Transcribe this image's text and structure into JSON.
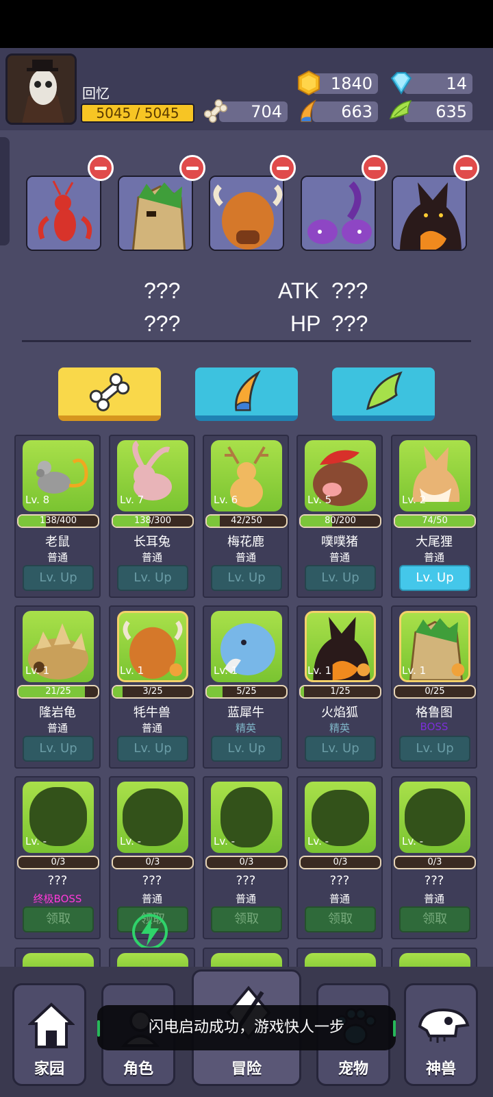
{
  "player": {
    "name": "回忆",
    "hp": "5045 / 5045"
  },
  "resources": {
    "gold": "1840",
    "diamond": "14",
    "bone": "704",
    "horn": "663",
    "wing": "635"
  },
  "team_stats": {
    "row1_left": "???",
    "row1_label": "ATK",
    "row1_value": "???",
    "row2_left": "???",
    "row2_label": "HP",
    "row2_value": "???"
  },
  "cards": [
    {
      "name": "老鼠",
      "rarity": "普通",
      "level": "Lv. 8",
      "progress": "138/400",
      "fill": 0.345,
      "button": "Lv. Up"
    },
    {
      "name": "长耳兔",
      "rarity": "普通",
      "level": "Lv. 7",
      "progress": "138/300",
      "fill": 0.46,
      "button": "Lv. Up"
    },
    {
      "name": "梅花鹿",
      "rarity": "普通",
      "level": "Lv. 6",
      "progress": "42/250",
      "fill": 0.168,
      "button": "Lv. Up"
    },
    {
      "name": "噗噗猪",
      "rarity": "普通",
      "level": "Lv. 5",
      "progress": "80/200",
      "fill": 0.4,
      "button": "Lv. Up"
    },
    {
      "name": "大尾狸",
      "rarity": "普通",
      "level": "Lv. 2",
      "progress": "74/50",
      "fill": 1.0,
      "button": "Lv. Up"
    },
    {
      "name": "隆岩龟",
      "rarity": "普通",
      "level": "Lv. 1",
      "progress": "21/25",
      "fill": 0.84,
      "button": "Lv. Up"
    },
    {
      "name": "牦牛兽",
      "rarity": "普通",
      "level": "Lv. 1",
      "progress": "3/25",
      "fill": 0.12,
      "button": "Lv. Up"
    },
    {
      "name": "蓝犀牛",
      "rarity": "精英",
      "level": "Lv. 1",
      "progress": "5/25",
      "fill": 0.2,
      "button": "Lv. Up"
    },
    {
      "name": "火焰狐",
      "rarity": "精英",
      "level": "Lv. 1",
      "progress": "1/25",
      "fill": 0.04,
      "button": "Lv. Up"
    },
    {
      "name": "格鲁图",
      "rarity": "BOSS",
      "level": "Lv. 1",
      "progress": "0/25",
      "fill": 0,
      "button": "Lv. Up"
    },
    {
      "name": "???",
      "rarity": "终极BOSS",
      "level": "Lv. -",
      "progress": "0/3",
      "fill": 0,
      "button": "领取"
    },
    {
      "name": "???",
      "rarity": "普通",
      "level": "Lv. -",
      "progress": "0/3",
      "fill": 0,
      "button": "领取"
    },
    {
      "name": "???",
      "rarity": "普通",
      "level": "Lv. -",
      "progress": "0/3",
      "fill": 0,
      "button": "领取"
    },
    {
      "name": "???",
      "rarity": "普通",
      "level": "Lv. -",
      "progress": "0/3",
      "fill": 0,
      "button": "领取"
    },
    {
      "name": "???",
      "rarity": "普通",
      "level": "Lv. -",
      "progress": "0/3",
      "fill": 0,
      "button": "领取"
    }
  ],
  "nav": {
    "home": "家园",
    "character": "角色",
    "adventure": "冒险",
    "pet": "宠物",
    "beast": "神兽"
  },
  "toast": "闪电启动成功，游戏快人一步",
  "colors": {
    "background": "#4b4a66",
    "card_green": "#8fd13e",
    "levelup_active": "#44c7ea",
    "ultimate_boss": "#ff3ad8",
    "boss": "#7b2fd8"
  }
}
